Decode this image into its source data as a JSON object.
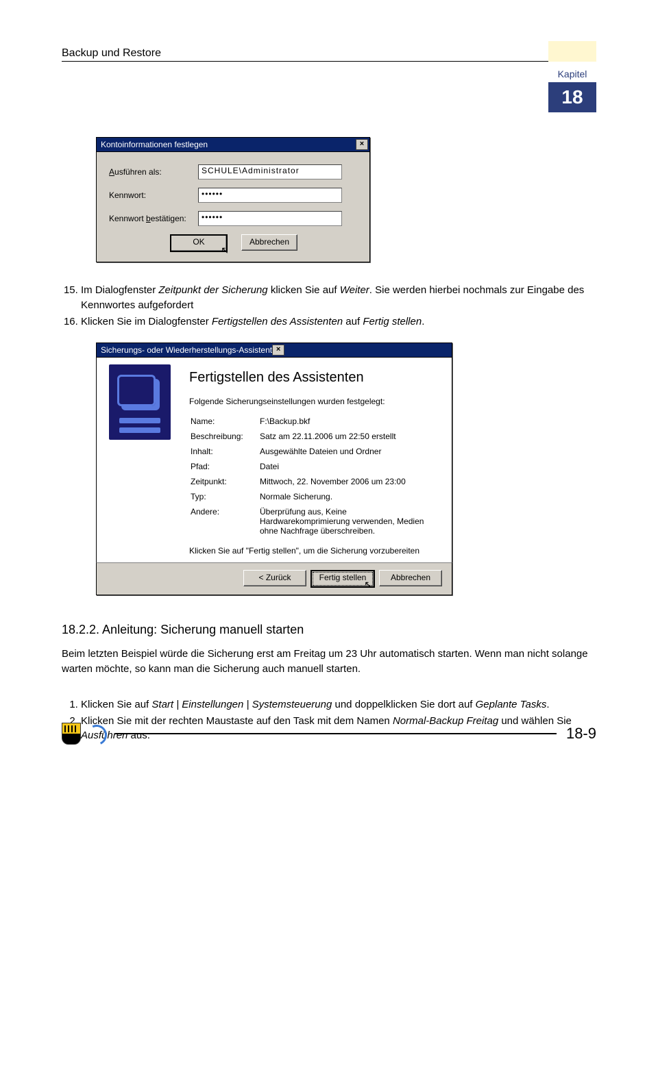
{
  "header": {
    "title": "Backup und Restore"
  },
  "chapter": {
    "label": "Kapitel",
    "number": "18"
  },
  "dialog1": {
    "title": "Kontoinformationen festlegen",
    "rows": {
      "user_label": "Ausführen als:",
      "user_value": "SCHULE\\Administrator",
      "pass_label": "Kennwort:",
      "pass_value": "••••••",
      "confirm_label": "Kennwort bestätigen:",
      "confirm_value": "••••••"
    },
    "buttons": {
      "ok": "OK",
      "cancel": "Abbrechen"
    }
  },
  "steps_a": {
    "start": 15,
    "items": [
      "Im Dialogfenster Zeitpunkt der Sicherung klicken Sie auf Weiter. Sie werden hierbei nochmals zur Eingabe des Kennwortes aufgefordert",
      "Klicken Sie im Dialogfenster Fertigstellen des Assistenten auf Fertig stellen."
    ]
  },
  "dialog2": {
    "title": "Sicherungs- oder Wiederherstellungs-Assistent",
    "heading": "Fertigstellen des Assistenten",
    "intro": "Folgende Sicherungseinstellungen wurden festgelegt:",
    "rows": [
      {
        "label": "Name:",
        "value": "F:\\Backup.bkf"
      },
      {
        "label": "Beschreibung:",
        "value": "Satz am 22.11.2006 um 22:50 erstellt"
      },
      {
        "label": "Inhalt:",
        "value": "Ausgewählte Dateien und Ordner"
      },
      {
        "label": "Pfad:",
        "value": "Datei"
      },
      {
        "label": "Zeitpunkt:",
        "value": "Mittwoch, 22. November 2006 um 23:00"
      },
      {
        "label": "Typ:",
        "value": "Normale Sicherung."
      },
      {
        "label": "Andere:",
        "value": "Überprüfung aus, Keine Hardwarekomprimierung verwenden, Medien ohne Nachfrage überschreiben."
      }
    ],
    "foot_note": "Klicken Sie auf \"Fertig stellen\", um die Sicherung vorzubereiten",
    "buttons": {
      "back": "< Zurück",
      "finish": "Fertig stellen",
      "cancel": "Abbrechen"
    }
  },
  "section": {
    "heading": "18.2.2. Anleitung: Sicherung manuell starten",
    "para": "Beim letzten Beispiel würde die Sicherung erst am Freitag um 23 Uhr automatisch starten. Wenn man nicht solange warten möchte, so kann man die Sicherung auch manuell starten.",
    "steps": [
      "Klicken Sie auf Start | Einstellungen | Systemsteuerung und doppelklicken Sie dort auf Geplante Tasks.",
      "Klicken Sie mit der rechten Maustaste auf den Task mit dem Namen Normal-Backup Freitag und wählen Sie Ausführen aus."
    ]
  },
  "footer": {
    "page": "18-9"
  }
}
